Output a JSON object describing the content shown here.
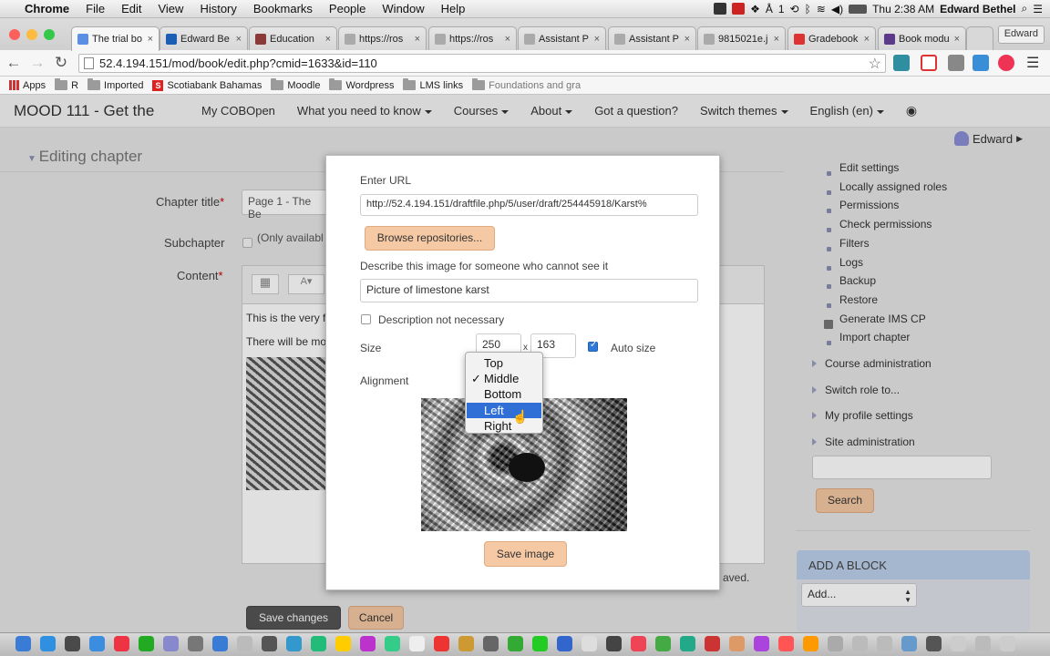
{
  "menubar": {
    "app": "Chrome",
    "items": [
      "File",
      "Edit",
      "View",
      "History",
      "Bookmarks",
      "People",
      "Window",
      "Help"
    ],
    "clock": "Thu 2:38 AM",
    "user": "Edward Bethel",
    "counter": "1"
  },
  "tabs": [
    {
      "label": "The trial bo",
      "color": "#5b8fe6"
    },
    {
      "label": "Edward Be",
      "color": "#1a5fb4"
    },
    {
      "label": "Education",
      "color": "#8b3a3a"
    },
    {
      "label": "https://ros",
      "color": "#aaa"
    },
    {
      "label": "https://ros",
      "color": "#aaa"
    },
    {
      "label": "Assistant P",
      "color": "#aaa"
    },
    {
      "label": "Assistant P",
      "color": "#aaa"
    },
    {
      "label": "9815021e.j",
      "color": "#aaa"
    },
    {
      "label": "Gradebook",
      "color": "#d33"
    },
    {
      "label": "Book modu",
      "color": "#5b3a8a"
    }
  ],
  "profile_button": "Edward",
  "url": "52.4.194.151/mod/book/edit.php?cmid=1633&id=110",
  "bookmarks": [
    {
      "label": "Apps",
      "icon": "apps-icon"
    },
    {
      "label": "R",
      "icon": "folder-icon"
    },
    {
      "label": "Imported",
      "icon": "folder-icon"
    },
    {
      "label": "Scotiabank Bahamas",
      "icon": "scotiabank-icon"
    },
    {
      "label": "Moodle",
      "icon": "folder-icon"
    },
    {
      "label": "Wordpress",
      "icon": "folder-icon"
    },
    {
      "label": "LMS links",
      "icon": "folder-icon"
    },
    {
      "label": "Foundations and gra",
      "icon": "folder-icon"
    }
  ],
  "site": {
    "brand": "MOOD 111 - Get the",
    "nav": [
      {
        "label": "My COBOpen",
        "caret": false
      },
      {
        "label": "What you need to know",
        "caret": true
      },
      {
        "label": "Courses",
        "caret": true
      },
      {
        "label": "About",
        "caret": true
      },
      {
        "label": "Got a question?",
        "caret": false
      },
      {
        "label": "Switch themes",
        "caret": true
      },
      {
        "label": "English (en)",
        "caret": true
      }
    ],
    "user": "Edward"
  },
  "form": {
    "section": "Editing chapter",
    "chapter_title_label": "Chapter title",
    "chapter_title_value": "Page 1 - The Be",
    "subchapter_label": "Subchapter",
    "subchapter_note": "(Only availabl",
    "content_label": "Content",
    "content_line1": "This is the very f",
    "content_line2": "There will be mo",
    "saved_note": "aved.",
    "save_changes": "Save changes",
    "cancel": "Cancel"
  },
  "dialog": {
    "enter_url_label": "Enter URL",
    "url_value": "http://52.4.194.151/draftfile.php/5/user/draft/254445918/Karst%",
    "browse_button": "Browse repositories...",
    "describe_label": "Describe this image for someone who cannot see it",
    "describe_value": "Picture of limestone karst",
    "not_necessary_label": "Description not necessary",
    "size_label": "Size",
    "width": "250",
    "x": "x",
    "height": "163",
    "auto_size_label": "Auto size",
    "alignment_label": "Alignment",
    "save_button": "Save image"
  },
  "alignment_options": [
    {
      "label": "Top",
      "checked": false,
      "highlighted": false
    },
    {
      "label": "Middle",
      "checked": true,
      "highlighted": false
    },
    {
      "label": "Bottom",
      "checked": false,
      "highlighted": false
    },
    {
      "label": "Left",
      "checked": false,
      "highlighted": true
    },
    {
      "label": "Right",
      "checked": false,
      "highlighted": false
    }
  ],
  "admin": {
    "links": [
      "Edit settings",
      "Locally assigned roles",
      "Permissions",
      "Check permissions",
      "Filters",
      "Logs",
      "Backup",
      "Restore",
      "Generate IMS CP",
      "Import chapter"
    ],
    "nodes": [
      "Course administration",
      "Switch role to...",
      "My profile settings",
      "Site administration"
    ],
    "search_button": "Search",
    "add_block_title": "ADD A BLOCK",
    "add_select": "Add..."
  }
}
